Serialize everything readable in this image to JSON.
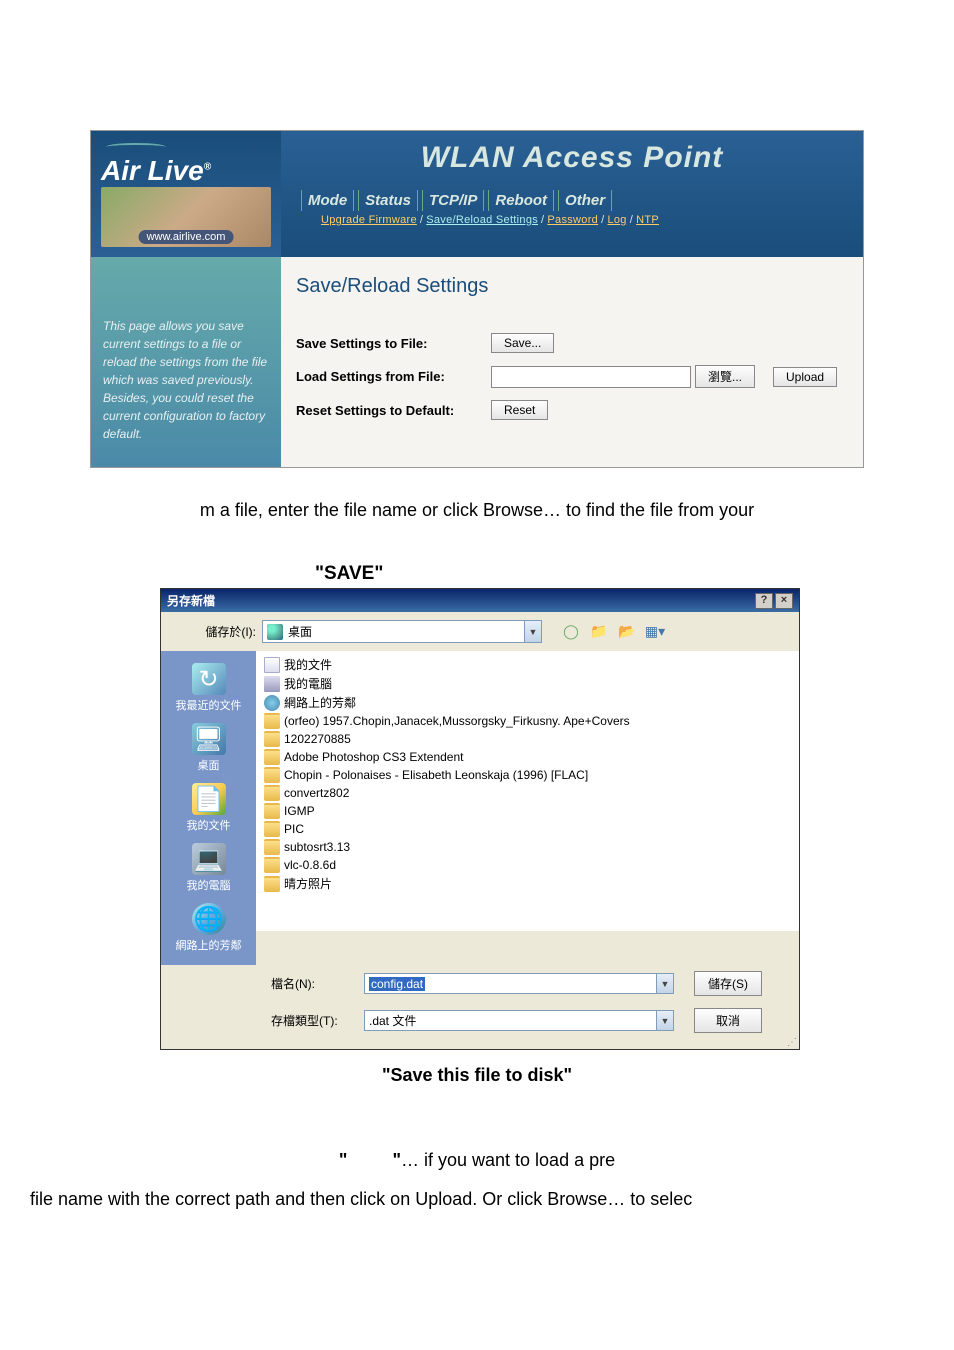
{
  "router": {
    "brand": "Air Live",
    "url": "www.airlive.com",
    "header_title": "WLAN Access Point",
    "tabs": [
      "Mode",
      "Status",
      "TCP/IP",
      "Reboot",
      "Other"
    ],
    "subnav": {
      "items": [
        "Upgrade Firmware",
        "Save/Reload Settings",
        "Password",
        "Log",
        "NTP"
      ]
    },
    "sidebar_text": "This page allows you save current settings to a file or reload the settings from the file which was saved previously. Besides, you could reset the current configuration to factory default.",
    "content_title": "Save/Reload Settings",
    "rows": {
      "save_label": "Save Settings to File:",
      "save_btn": "Save...",
      "load_label": "Load Settings from File:",
      "browse_btn": "瀏覽...",
      "upload_btn": "Upload",
      "reset_label": "Reset Settings to Default:",
      "reset_btn": "Reset"
    }
  },
  "text1": "m a file, enter the file name or click Browse… to find the file from your",
  "save_heading": "\"SAVE\"",
  "dialog": {
    "title": "另存新檔",
    "save_in_label": "儲存於(I):",
    "location": "桌面",
    "places": {
      "recent": "我最近的文件",
      "desktop": "桌面",
      "documents": "我的文件",
      "computer": "我的電腦",
      "network": "網路上的芳鄰"
    },
    "files": [
      "我的文件",
      "我的電腦",
      "網路上的芳鄰",
      "(orfeo) 1957.Chopin,Janacek,Mussorgsky_Firkusny. Ape+Covers",
      "1202270885",
      "Adobe Photoshop CS3 Extendent",
      "Chopin - Polonaises - Elisabeth Leonskaja (1996) [FLAC]",
      "convertz802",
      "IGMP",
      "PIC",
      "subtosrt3.13",
      "vlc-0.8.6d",
      "晴方照片"
    ],
    "filename_label": "檔名(N):",
    "filename_value": "config.dat",
    "filetype_label": "存檔類型(T):",
    "filetype_value": ".dat 文件",
    "save_btn": "儲存(S)",
    "cancel_btn": "取消"
  },
  "save_disk": "\"Save this file to disk\"",
  "bottom1a": "\"",
  "bottom1b": "\"",
  "bottom1c": "… if you want to load a pre",
  "bottom2": "file name with the correct path and then click on Upload. Or click Browse… to selec"
}
